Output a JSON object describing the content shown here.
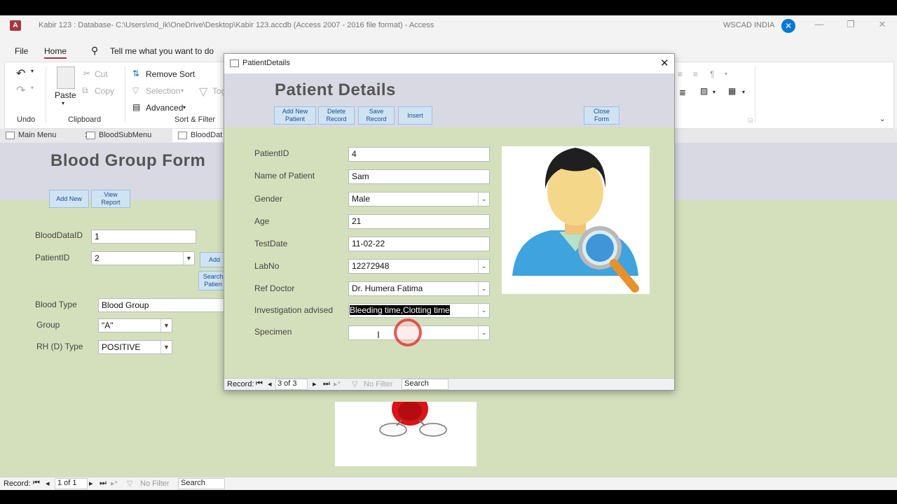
{
  "window": {
    "title": "Kabir 123 : Database- C:\\Users\\md_ik\\OneDrive\\Desktop\\Kabir 123.accdb (Access 2007 - 2016 file format)  -  Access",
    "app_logo": "A",
    "user": "WSCAD INDIA",
    "user_initial": "✕"
  },
  "menu": {
    "file": "File",
    "home": "Home",
    "tell_me": "Tell me what you want to do"
  },
  "ribbon": {
    "undo_group": "Undo",
    "clipboard_group": "Clipboard",
    "paste": "Paste",
    "cut": "Cut",
    "copy": "Copy",
    "sortfilter_group": "Sort & Filter",
    "remove_sort": "Remove Sort",
    "selection": "Selection",
    "advanced": "Advanced",
    "toggle_filter": "Tog"
  },
  "doc_tabs": [
    "Main Menu",
    "BloodSubMenu",
    "BloodDat"
  ],
  "blood_form": {
    "title": "Blood Group Form",
    "add_new": "Add New",
    "view_report": "View\nReport",
    "add": "Add",
    "search_patient": "Search\nPatien",
    "fields": {
      "blooddataid_label": "BloodDataID",
      "blooddataid_value": "1",
      "patientid_label": "PatientID",
      "patientid_value": "2",
      "bloodtype_label": "Blood Type",
      "bloodtype_value": "Blood Group",
      "group_label": "Group",
      "group_value": "\"A\"",
      "rh_label": "RH (D) Type",
      "rh_value": "POSITIVE"
    }
  },
  "status": {
    "record_label": "Record:",
    "record_pos": "1 of 1",
    "no_filter": "No Filter",
    "search": "Search"
  },
  "popup": {
    "window_title": "PatientDetails",
    "heading": "Patient Details",
    "buttons": {
      "add_new_patient": "Add New\nPatient",
      "delete_record": "Delete\nRecord",
      "save_record": "Save\nRecord",
      "insert": "Insert",
      "close_form": "Close\nForm"
    },
    "fields": {
      "patientid_label": "PatientID",
      "patientid_value": "4",
      "name_label": "Name of Patient",
      "name_value": "Sam",
      "gender_label": "Gender",
      "gender_value": "Male",
      "age_label": "Age",
      "age_value": "21",
      "testdate_label": "TestDate",
      "testdate_value": "11-02-22",
      "labno_label": "LabNo",
      "labno_value": "12272948",
      "refdoctor_label": "Ref Doctor",
      "refdoctor_value": "Dr. Humera Fatima",
      "investigation_label": "Investigation advised",
      "investigation_value": "Bleeding time,Clotting time",
      "specimen_label": "Specimen",
      "specimen_value": ""
    },
    "status": {
      "record_label": "Record:",
      "record_pos": "3 of 3",
      "no_filter": "No Filter",
      "search": "Search"
    }
  }
}
